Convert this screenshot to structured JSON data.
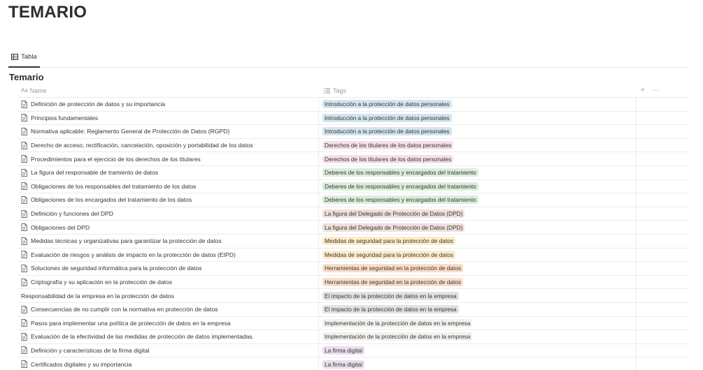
{
  "page": {
    "title": "TEMARIO"
  },
  "view": {
    "tab_label": "Tabla"
  },
  "database": {
    "title": "Temario"
  },
  "columns": {
    "name": "Name",
    "tags": "Tags",
    "add": "+",
    "more": "···"
  },
  "colors": {
    "blue": "#d3e5ef",
    "pink": "#f5e0e9",
    "green": "#dbeddb",
    "brown": "#eee0da",
    "yellow": "#fdecc8",
    "orange": "#fadec9",
    "gray": "#e3e2e0",
    "lightgray": "#f1f1ef",
    "purple": "#e8deee"
  },
  "rows": [
    {
      "name": "Definición de protección de datos y su importancia",
      "tag": "Introducción a la protección de datos personales",
      "color": "blue",
      "icon": "page-icon"
    },
    {
      "name": "Principios fundamentales",
      "tag": "Introducción a la protección de datos personales",
      "color": "blue",
      "icon": "page-icon"
    },
    {
      "name": "Normativa aplicable: Reglamento General de Protección de Datos (RGPD)",
      "tag": "Introducción a la protección de datos personales",
      "color": "blue",
      "icon": "page-icon"
    },
    {
      "name": "Derecho de acceso, rectificación, cancelación, oposición y portabilidad de los datos",
      "tag": "Derechos de los titulares de los datos personales",
      "color": "pink",
      "icon": "page-icon"
    },
    {
      "name": "Procedimientos para el ejercicio de los derechos de los titulares",
      "tag": "Derechos de los titulares de los datos personales",
      "color": "pink",
      "icon": "page-icon"
    },
    {
      "name": "La figura del responsable de tramiento de datos",
      "tag": "Deberes de los responsables y encargados del tratamiento",
      "color": "green",
      "icon": "page-icon"
    },
    {
      "name": "Obligaciones de los responsables del tratamiento de los datos",
      "tag": "Deberes de los responsables y encargados del tratamiento",
      "color": "green",
      "icon": "page-icon"
    },
    {
      "name": "Obligaciones de los encargados del tratamiento de los datos",
      "tag": "Deberes de los responsables y encargados del tratamiento",
      "color": "green",
      "icon": "page-icon"
    },
    {
      "name": "Definición y funciones del DPD",
      "tag": "La figura del Delegado de Protección de Datos (DPD)",
      "color": "brown",
      "icon": "page-icon"
    },
    {
      "name": "Obligaciones del DPD",
      "tag": "La figura del Delegado de Protección de Datos (DPD)",
      "color": "brown",
      "icon": "page-icon"
    },
    {
      "name": "Medidas técnicas y organizativas para garantizar la protección de datos",
      "tag": "Medidas de seguridad para la protección de datos",
      "color": "yellow",
      "icon": "page-icon"
    },
    {
      "name": "Evaluación de riesgos y análisis de impacto en la protección de datos (EIPD)",
      "tag": "Medidas de seguridad para la protección de datos",
      "color": "yellow",
      "icon": "page-icon"
    },
    {
      "name": "Soluciones de seguridad informática para la protección de datos",
      "tag": "Herramientas de seguridad en la protección de datos",
      "color": "orange",
      "icon": "page-icon"
    },
    {
      "name": "Criptografía y su aplicación en la protección de datos",
      "tag": "Herramientas de seguridad en la protección de datos",
      "color": "orange",
      "icon": "page-icon"
    },
    {
      "name": "Responsabilidad de la empresa en la protección de datos",
      "tag": "El impacto de la protección de datos en la empresa",
      "color": "gray",
      "icon": "none"
    },
    {
      "name": "Consecuencias de no cumplir con la normativa en protección de datos",
      "tag": "El impacto de la protección de datos en la empresa",
      "color": "gray",
      "icon": "page-icon"
    },
    {
      "name": "Pasos para implementar una política de protección de datos en la empresa",
      "tag": "Implementación de la protección de datos en la empresa",
      "color": "lightgray",
      "icon": "page-icon"
    },
    {
      "name": "Evaluación de la efectividad de las medidas de protección de datos implementadas.",
      "tag": "Implementación de la protección de datos en la empresa",
      "color": "lightgray",
      "icon": "page-icon"
    },
    {
      "name": "Definición y características de la firma digital",
      "tag": "La firma digital",
      "color": "purple",
      "icon": "page-icon"
    },
    {
      "name": "Certificados digitales y su importancia",
      "tag": "La firma digital",
      "color": "purple",
      "icon": "page-icon"
    }
  ]
}
